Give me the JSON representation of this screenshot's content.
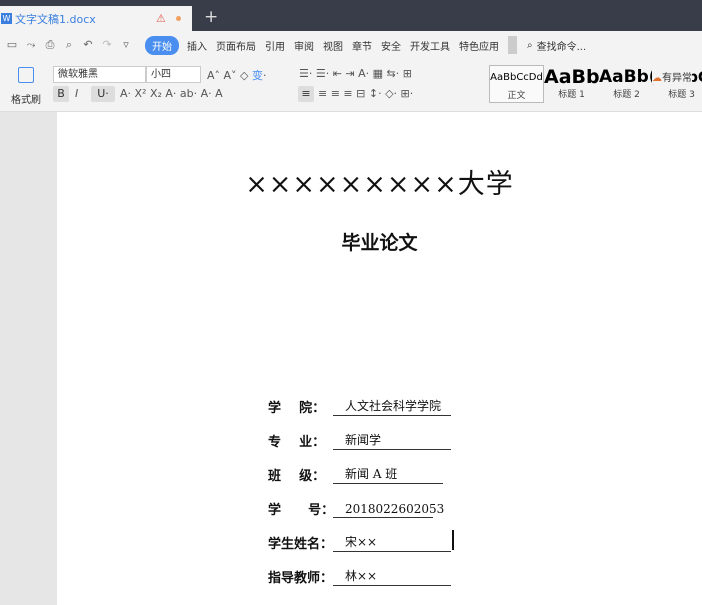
{
  "tab": {
    "icon": "W",
    "name": "文字文稿1.docx",
    "warn": "⚠",
    "new_tab": "+"
  },
  "menu": {
    "items": [
      "开始",
      "插入",
      "页面布局",
      "引用",
      "审阅",
      "视图",
      "章节",
      "安全",
      "开发工具",
      "特色应用"
    ],
    "find": "查找命令...",
    "cloud": "有异常"
  },
  "toolbar": {
    "brush": "格式刷",
    "font": "微软雅黑",
    "size": "小四",
    "styles": [
      {
        "preview": "AaBbCcDd",
        "label": "正文"
      },
      {
        "preview": "AaBb",
        "label": "标题 1"
      },
      {
        "preview": "AaBb(",
        "label": "标题 2"
      },
      {
        "preview": "AaBbC",
        "label": "标题 3"
      }
    ]
  },
  "doc": {
    "title": "×××××××××大学",
    "subtitle": "毕业论文",
    "fields": [
      {
        "label": "学    院：",
        "value": "人文社会科学学院"
      },
      {
        "label": "专    业：",
        "value": "新闻学"
      },
      {
        "label": "班    级：",
        "value": " 新闻 A 班"
      },
      {
        "label": "学      号：",
        "value": "2018022602053"
      },
      {
        "label": "学生姓名：",
        "value": " 宋××"
      },
      {
        "label": "指导教师：",
        "value": " 林××"
      }
    ]
  }
}
